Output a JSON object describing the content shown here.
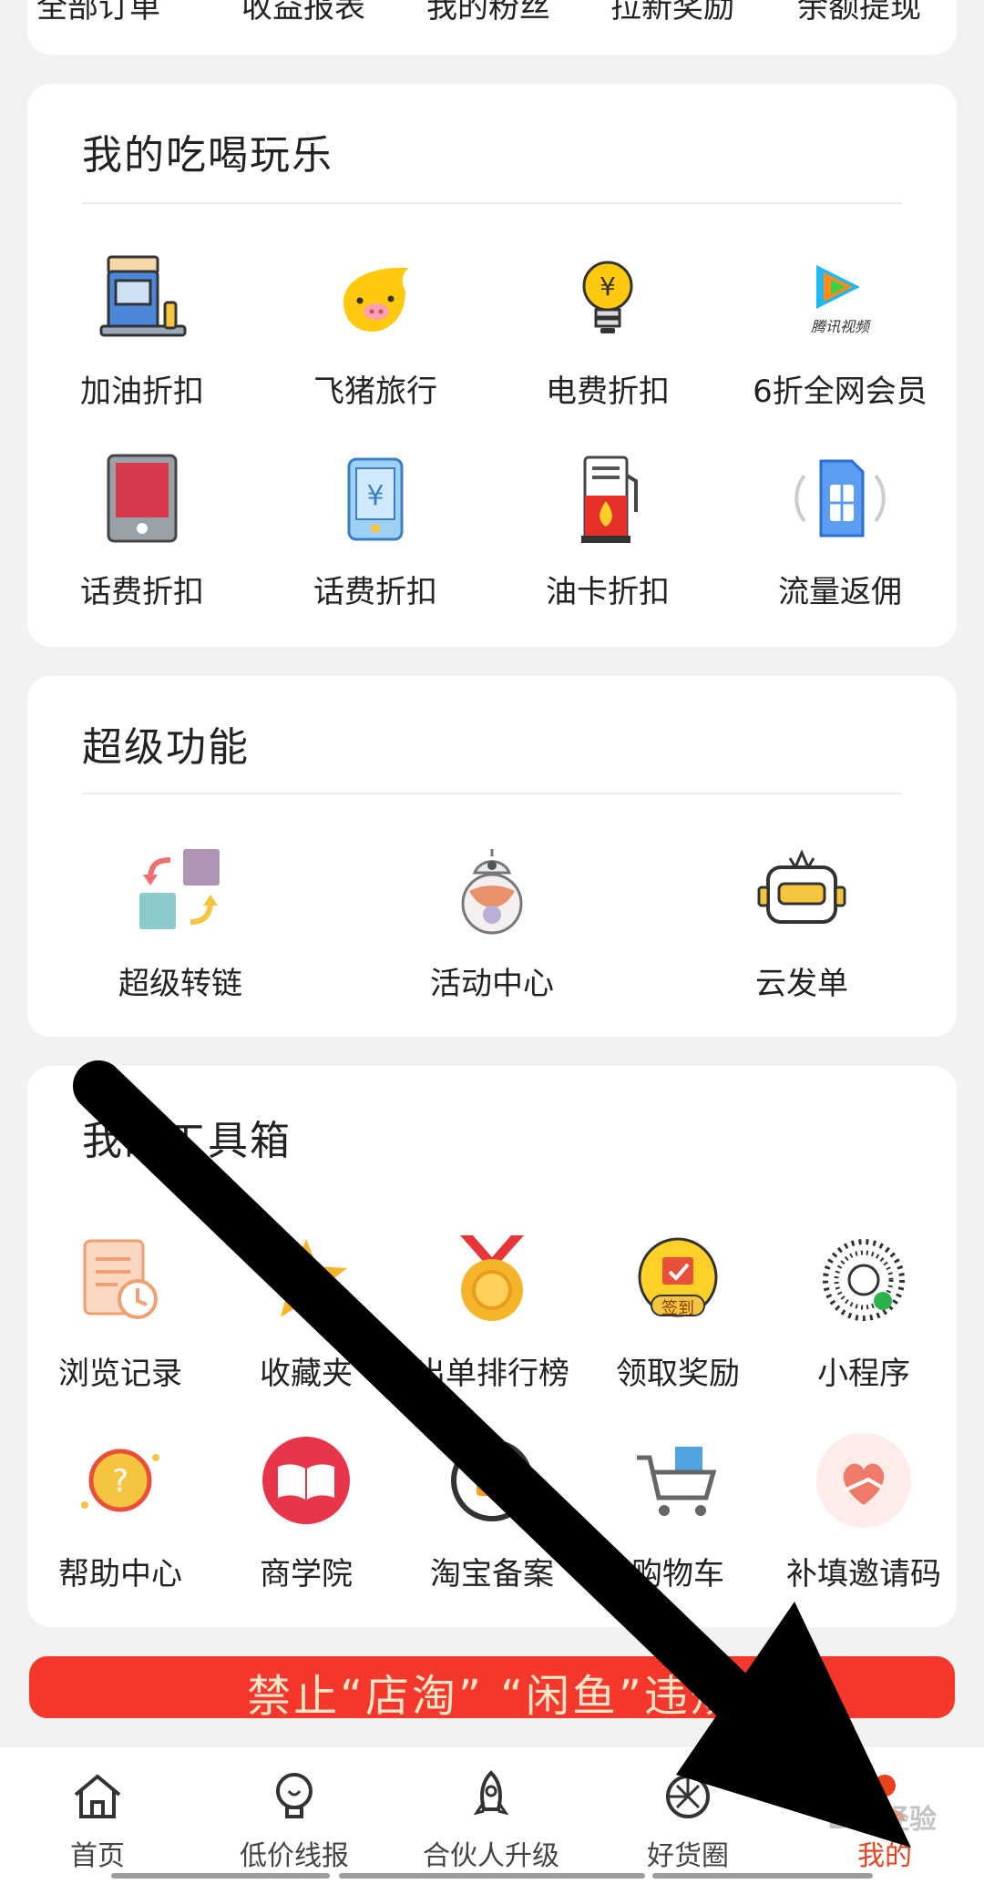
{
  "top_row": {
    "labels": [
      "全部订单",
      "收益报表",
      "我的粉丝",
      "拉新奖励",
      "余额提现"
    ]
  },
  "section_eat": {
    "title": "我的吃喝玩乐",
    "items": [
      {
        "label": "加油折扣",
        "icon": "gas-pump-icon"
      },
      {
        "label": "飞猪旅行",
        "icon": "fliggy-pig-icon"
      },
      {
        "label": "电费折扣",
        "icon": "lightbulb-yuan-icon"
      },
      {
        "label": "6折全网会员",
        "icon": "tencent-video-icon",
        "icon_text": "腾讯视频"
      },
      {
        "label": "话费折扣",
        "icon": "tablet-icon"
      },
      {
        "label": "话费折扣",
        "icon": "phone-yuan-icon"
      },
      {
        "label": "油卡折扣",
        "icon": "fuel-card-icon"
      },
      {
        "label": "流量返佣",
        "icon": "sim-card-icon"
      }
    ]
  },
  "section_super": {
    "title": "超级功能",
    "items": [
      {
        "label": "超级转链",
        "icon": "convert-link-icon"
      },
      {
        "label": "活动中心",
        "icon": "robot-ball-icon"
      },
      {
        "label": "云发单",
        "icon": "robot-head-icon"
      }
    ]
  },
  "section_tools": {
    "title": "我的工具箱",
    "items": [
      {
        "label": "浏览记录",
        "icon": "history-icon"
      },
      {
        "label": "收藏夹",
        "icon": "star-icon"
      },
      {
        "label": "出单排行榜",
        "icon": "medal-icon"
      },
      {
        "label": "领取奖励",
        "icon": "checkin-icon",
        "icon_text": "签到"
      },
      {
        "label": "小程序",
        "icon": "mini-program-icon"
      },
      {
        "label": "帮助中心",
        "icon": "help-icon"
      },
      {
        "label": "商学院",
        "icon": "book-icon"
      },
      {
        "label": "淘宝备案",
        "icon": "taobao-record-icon"
      },
      {
        "label": "购物车",
        "icon": "cart-icon"
      },
      {
        "label": "补填邀请码",
        "icon": "heart-hand-icon"
      }
    ]
  },
  "banner": {
    "text": "禁止“店淘” “闲鱼”违规"
  },
  "tabbar": {
    "tabs": [
      {
        "label": "首页",
        "icon": "home-icon"
      },
      {
        "label": "低价线报",
        "icon": "bulb-icon"
      },
      {
        "label": "合伙人升级",
        "icon": "rocket-icon"
      },
      {
        "label": "好货圈",
        "icon": "aperture-icon"
      },
      {
        "label": "我的",
        "icon": "user-icon"
      }
    ],
    "active_index": 4
  },
  "watermark": "Bai经验",
  "colors": {
    "accent": "#e8431d",
    "banner": "#f5382b"
  }
}
